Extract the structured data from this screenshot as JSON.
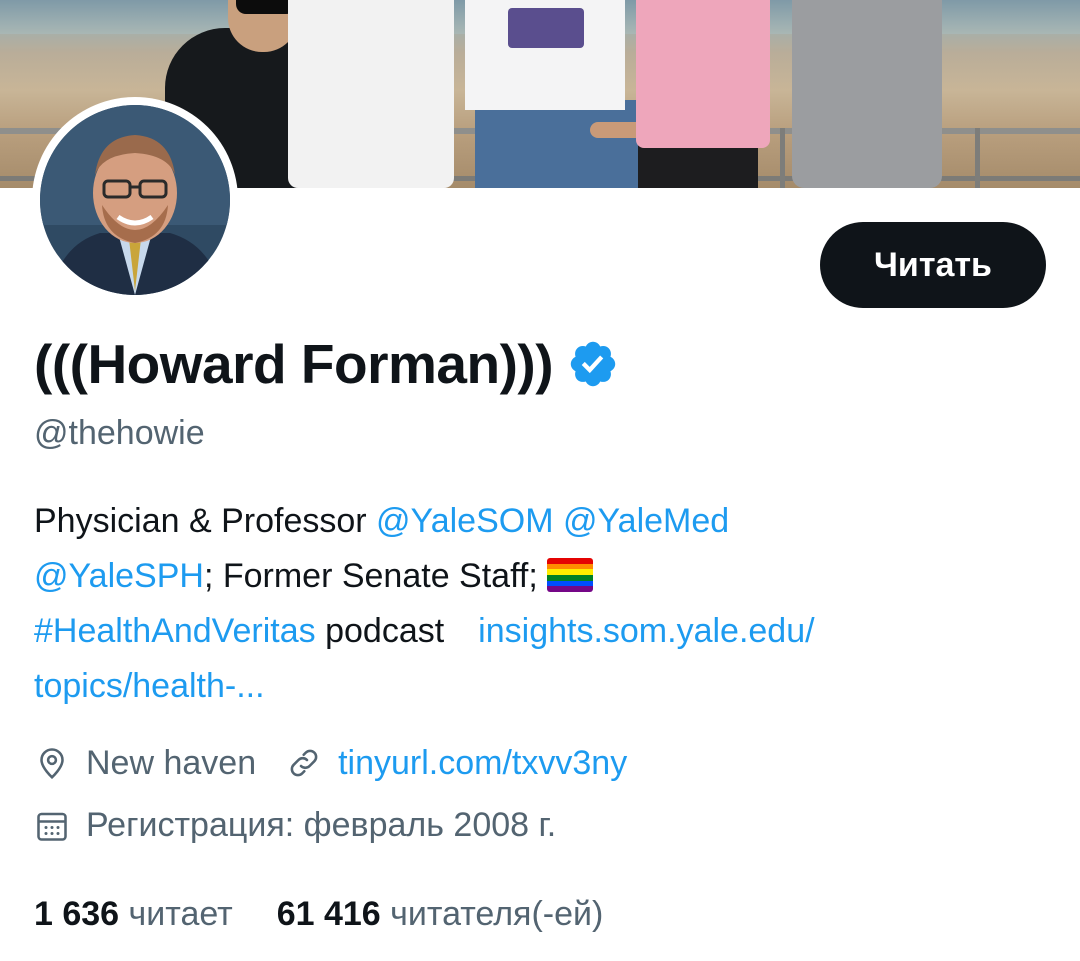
{
  "profile": {
    "display_name": "(((Howard Forman)))",
    "handle": "@thehowie",
    "verified": true,
    "follow_button_label": "Читать"
  },
  "bio": {
    "line1_text": "Physician & Professor ",
    "mention_som": "@YaleSOM",
    "mention_med": "@YaleMed",
    "mention_sph": "@YaleSPH",
    "line2_text": "; Former Senate Staff; ",
    "flag_emoji": "rainbow-flag",
    "hashtag": "#HealthAndVeritas",
    "line3_text": " podcast",
    "url_part1": "insights.som.yale.edu/",
    "url_part2": "topics/health-..."
  },
  "meta": {
    "location": "New haven",
    "website": "tinyurl.com/txvv3ny",
    "joined": "Регистрация: февраль 2008 г.",
    "icons": [
      "location-pin-icon",
      "link-icon",
      "calendar-icon"
    ]
  },
  "stats": {
    "following_count": "1 636",
    "following_label": "читает",
    "followers_count": "61 416",
    "followers_label": "читателя(-ей)"
  },
  "colors": {
    "link": "#1d9bf0",
    "secondary_text": "#536471",
    "primary_text": "#0f1419",
    "button_bg": "#0f1419",
    "verified_badge": "#1d9bf0"
  }
}
